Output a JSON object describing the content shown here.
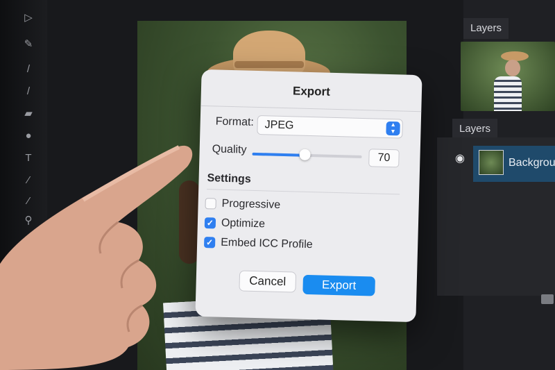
{
  "toolbar": {
    "tools": [
      "pen-tool-icon",
      "brush-icon",
      "pencil-icon",
      "clone-icon",
      "eraser-icon",
      "blur-icon",
      "type-icon",
      "eyedropper-icon",
      "smudge-icon",
      "zoom-icon"
    ]
  },
  "panels": {
    "top_tab": "Layers",
    "layers_tab": "Layers",
    "layer_name": "Background"
  },
  "dialog": {
    "title": "Export",
    "format_label": "Format:",
    "format_value": "JPEG",
    "quality_label": "Quality",
    "quality_value": "70",
    "quality_fraction": 0.48,
    "settings_label": "Settings",
    "options": [
      {
        "label": "Progressive",
        "checked": false
      },
      {
        "label": "Optimize",
        "checked": true
      },
      {
        "label": "Embed ICC Profile",
        "checked": true
      }
    ],
    "cancel_label": "Cancel",
    "export_label": "Export"
  },
  "colors": {
    "accent": "#1a8cf0",
    "panel_bg": "#1f2024",
    "dialog_bg": "#ececef"
  }
}
